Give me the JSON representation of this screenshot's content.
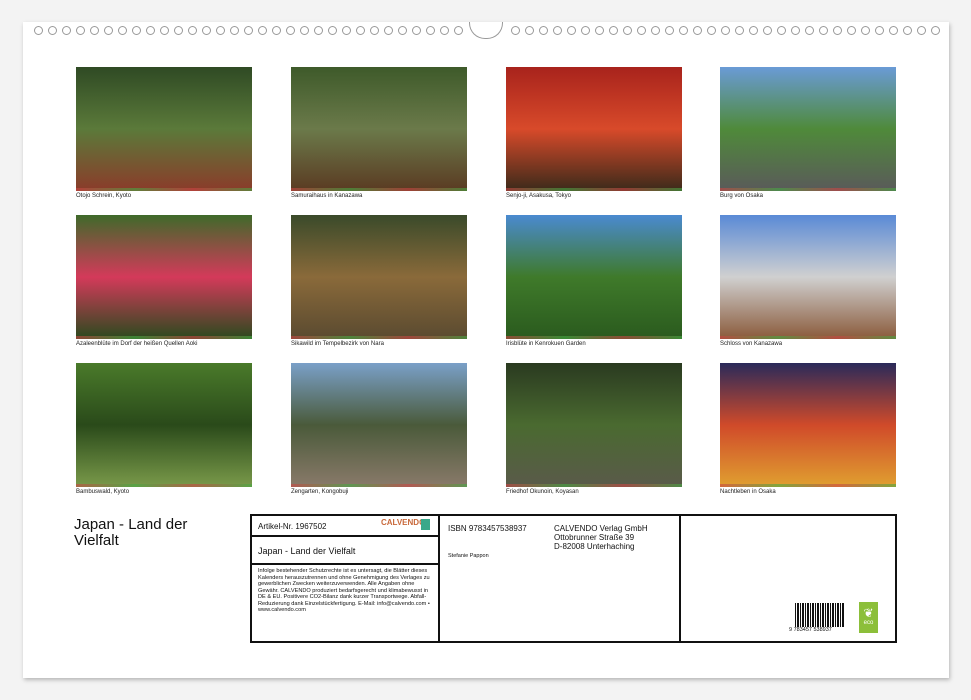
{
  "photos": [
    {
      "caption": "Otojo Schrein, Kyoto",
      "colors": [
        "#2f4a24",
        "#5b7a3a",
        "#8b3b2a"
      ]
    },
    {
      "caption": "Samuraihaus in Kanazawa",
      "colors": [
        "#3e5a2a",
        "#6b7a4a",
        "#5a3a22"
      ]
    },
    {
      "caption": "Senjo-ji, Asakusa, Tokyo",
      "colors": [
        "#a8231c",
        "#d84a2a",
        "#3a2a1a"
      ]
    },
    {
      "caption": "Burg von Osaka",
      "colors": [
        "#6a9bd6",
        "#4f8a3a",
        "#5a5a5a"
      ]
    },
    {
      "caption": "Azaleenblüte im Dorf der heißen Quellen Aoki",
      "colors": [
        "#3f6a2a",
        "#d43a5a",
        "#2a4a1e"
      ]
    },
    {
      "caption": "Sikawild im Tempelbezirk von Nara",
      "colors": [
        "#3a4a2a",
        "#8a6a3a",
        "#5a4a30"
      ]
    },
    {
      "caption": "Irisblüte in Kenrokuen Garden",
      "colors": [
        "#4a8ad0",
        "#3f7a2a",
        "#2a5a1e"
      ]
    },
    {
      "caption": "Schloss von Kanazawa",
      "colors": [
        "#5a8ad6",
        "#d0d0d0",
        "#8a5a3a"
      ]
    },
    {
      "caption": "Bambuswald, Kyoto",
      "colors": [
        "#4a7a2a",
        "#2a4a1a",
        "#7a9a4a"
      ]
    },
    {
      "caption": "Zengarten, Kongobuji",
      "colors": [
        "#7aa0c8",
        "#4a5a3a",
        "#8a7a6a"
      ]
    },
    {
      "caption": "Friedhof Okunoin, Koyasan",
      "colors": [
        "#2a3a20",
        "#4a6a30",
        "#5a5a4a"
      ]
    },
    {
      "caption": "Nachtleben in Osaka",
      "colors": [
        "#2a2a5a",
        "#d04a2a",
        "#e0a030"
      ]
    }
  ],
  "cover_title": "Japan - Land der Vielfalt",
  "info": {
    "article": "Artikel-Nr. 1967502",
    "brand": "CALVENDO",
    "title": "Japan - Land der Vielfalt",
    "legal": "Infolge bestehender Schutzrechte ist es untersagt, die Blätter dieses Kalenders herauszutrennen und ohne Genehmigung des Verlages zu gewerblichen Zwecken weiterzuverwenden. Alle Angaben ohne Gewähr. CALVENDO produziert bedarfsgerecht und klimabewusst in DE & EU. Positivere CO2-Bilanz dank kurzer Transportwege. Abfall-Reduzierung dank Einzelstückfertigung. E-Mail: info@calvendo.com • www.calvendo.com",
    "isbn": "ISBN 9783457538937",
    "author": "Stefanie Pappon",
    "publisher1": "CALVENDO Verlag GmbH",
    "publisher2": "Ottobrunner Straße 39",
    "publisher3": "D-82008 Unterhaching",
    "barcode": "9 783457 538937",
    "eco": "eco"
  }
}
